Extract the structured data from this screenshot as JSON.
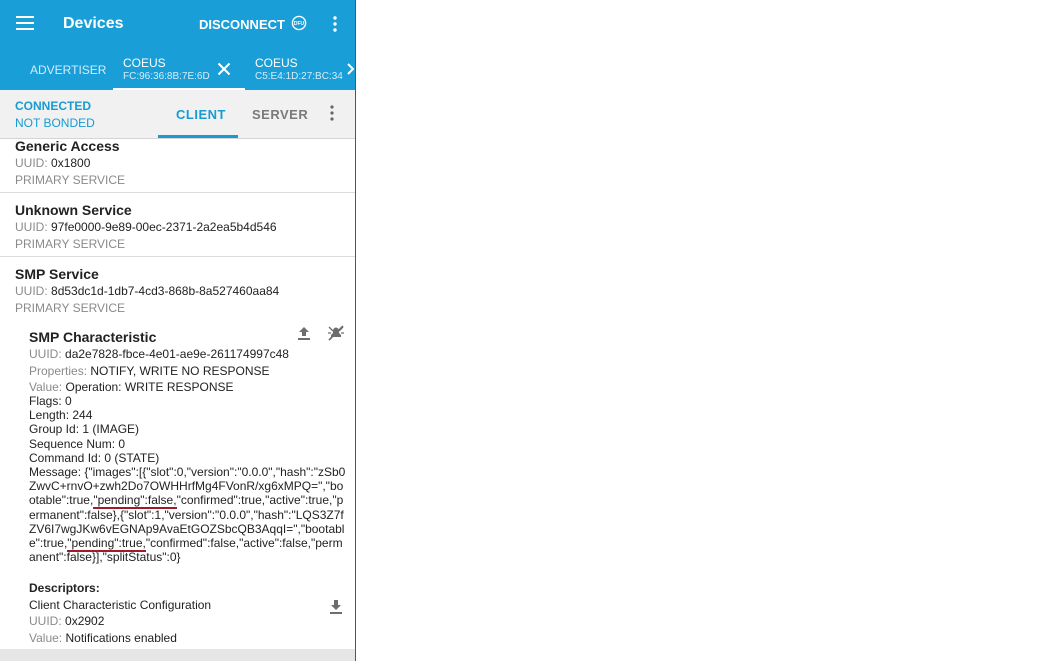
{
  "appbar": {
    "title": "Devices",
    "disconnect_label": "DISCONNECT",
    "dfu_label": "DFU"
  },
  "device_tabs": [
    {
      "label": "ADVERTISER"
    },
    {
      "name": "COEUS",
      "address": "FC:96:36:8B:7E:6D"
    },
    {
      "name": "COEUS",
      "address": "C5:E4:1D:27:BC:34"
    }
  ],
  "connection": {
    "status": "CONNECTED",
    "bond": "NOT BONDED",
    "tab_client": "CLIENT",
    "tab_server": "SERVER"
  },
  "uuid_label": "UUID:",
  "services": [
    {
      "name": "Generic Access",
      "uuid": "0x1800",
      "type": "PRIMARY SERVICE"
    },
    {
      "name": "Unknown Service",
      "uuid": "97fe0000-9e89-00ec-2371-2a2ea5b4d546",
      "type": "PRIMARY SERVICE"
    },
    {
      "name": "SMP Service",
      "uuid": "8d53dc1d-1db7-4cd3-868b-8a527460aa84",
      "type": "PRIMARY SERVICE"
    }
  ],
  "characteristic": {
    "name": "SMP Characteristic",
    "uuid": "da2e7828-fbce-4e01-ae9e-261174997c48",
    "properties_label": "Properties:",
    "properties": "NOTIFY, WRITE NO RESPONSE",
    "value_label": "Value:",
    "value": "Operation: WRITE RESPONSE",
    "flags": "Flags: 0",
    "length": "Length: 244",
    "group_id": "Group Id: 1 (IMAGE)",
    "sequence": "Sequence Num: 0",
    "command": "Command Id: 0 (STATE)",
    "message": {
      "part1": "Message: {\"images\":[{\"slot\":0,\"version\":\"0.0.0\",\"hash\":\"zSb0ZwvC+rnvO+zwh2Do7OWHHrfMg4FVonR/xg6xMPQ=\",\"bootable\":true,",
      "highlight1": "\"pending\":false,",
      "part2": "\"confirmed\":true,\"active\":true,\"permanent\":false},{\"slot\":1,\"version\":\"0.0.0\",\"hash\":\"LQS3Z7fZV6I7wgJKw6vEGNAp9AvaEtGOZSbcQB3AqqI=\",\"bootable\":true,",
      "highlight2": "\"pending\":true,",
      "part3": "\"confirmed\":false,\"active\":false,\"permanent\":false}],\"splitStatus\":0}"
    }
  },
  "descriptors": {
    "title": "Descriptors:",
    "items": [
      {
        "name": "Client Characteristic Configuration",
        "uuid": "0x2902",
        "value_label": "Value:",
        "value": "Notifications enabled"
      }
    ]
  }
}
